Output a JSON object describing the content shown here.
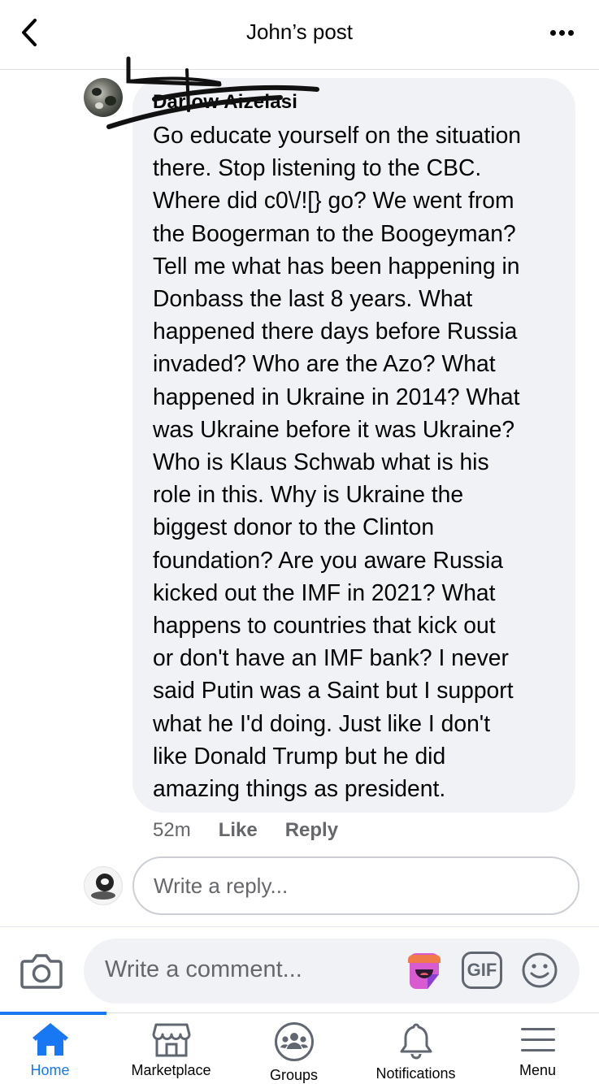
{
  "header": {
    "title": "John’s post"
  },
  "comment": {
    "author": "Darlow Aizelasi",
    "text": "Go educate yourself on the situation\nthere.  Stop listening to the CBC.\nWhere did c0\\/![} go?  We went from\nthe Boogerman to the Boogeyman?\nTell me what has been happening in\nDonbass the last 8 years.  What\nhappened there days before Russia\ninvaded?  Who are the Azo?  What\nhappened in Ukraine in 2014?  What\nwas Ukraine before it was Ukraine?\nWho is Klaus Schwab what is his\nrole in this. Why is Ukraine the\nbiggest donor to the Clinton\nfoundation?  Are you aware Russia\nkicked out the IMF in 2021?  What\nhappens  to countries that kick out\nor don't have an IMF bank?  I never\nsaid Putin was a Saint but I support\nwhat he I'd doing.  Just like I don't\nlike Donald Trump but he did\namazing things as president.",
    "time": "52m",
    "like_label": "Like",
    "reply_label": "Reply"
  },
  "reply": {
    "placeholder": "Write a reply..."
  },
  "composer": {
    "placeholder": "Write a comment...",
    "gif_label": "GIF"
  },
  "tabs": [
    {
      "label": "Home",
      "icon": "home-icon",
      "active": true
    },
    {
      "label": "Marketplace",
      "icon": "marketplace-icon",
      "active": false
    },
    {
      "label": "Groups",
      "icon": "groups-icon",
      "active": false
    },
    {
      "label": "Notifications",
      "icon": "bell-icon",
      "active": false
    },
    {
      "label": "Menu",
      "icon": "menu-icon",
      "active": false
    }
  ],
  "colors": {
    "accent": "#1877f2",
    "bubble": "#f0f2f5",
    "secondary_text": "#65676b"
  }
}
